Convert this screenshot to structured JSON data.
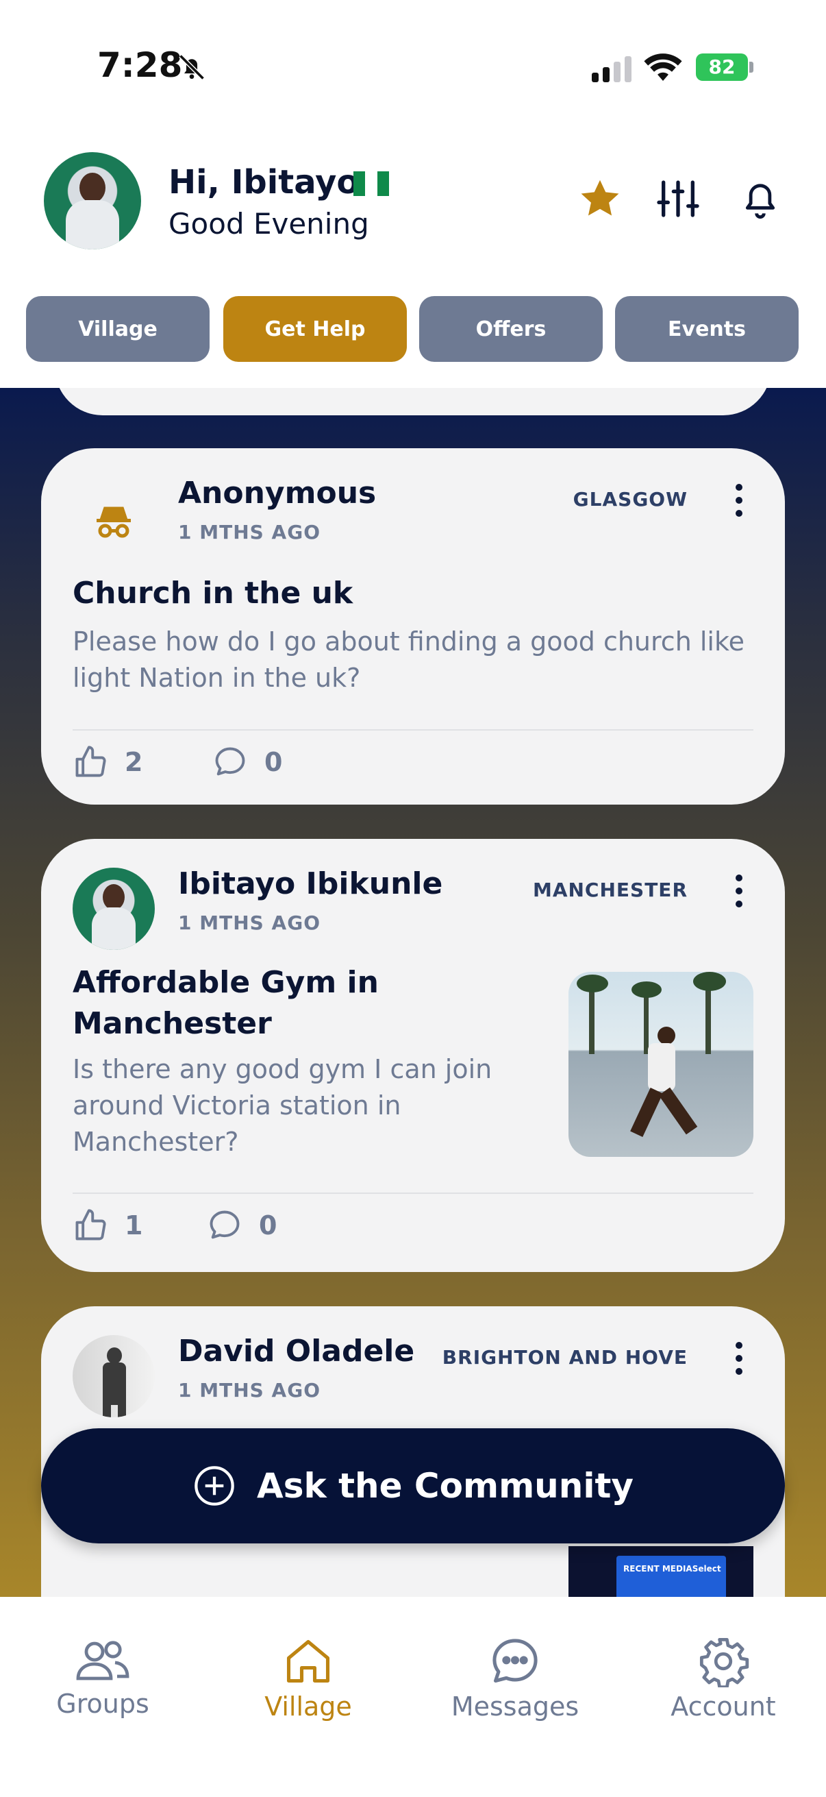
{
  "status_bar": {
    "time": "7:28",
    "battery": "82"
  },
  "header": {
    "greeting": "Hi, Ibitayo",
    "subgreeting": "Good Evening"
  },
  "tabs": [
    {
      "label": "Village"
    },
    {
      "label": "Get Help",
      "active": true
    },
    {
      "label": "Offers"
    },
    {
      "label": "Events"
    }
  ],
  "posts": [
    {
      "author": "Anonymous",
      "time": "1 MTHS AGO",
      "location": "GLASGOW",
      "title": "Church in the uk",
      "body": "Please how do I go about finding a good church like light Nation in the uk?",
      "likes": "2",
      "comments": "0"
    },
    {
      "author": "Ibitayo Ibikunle",
      "time": "1 MTHS AGO",
      "location": "MANCHESTER",
      "title": "Affordable Gym in Manchester",
      "body": "Is there any good gym I can join around Victoria station in Manchester?",
      "likes": "1",
      "comments": "0"
    },
    {
      "author": "David Oladele",
      "time": "1 MTHS AGO",
      "location": "BRIGHTON AND HOVE"
    }
  ],
  "thumbnail_text": "RECENT MEDIASelect",
  "cta_label": "Ask the Community",
  "bottom_nav": [
    {
      "label": "Groups"
    },
    {
      "label": "Village",
      "active": true
    },
    {
      "label": "Messages"
    },
    {
      "label": "Account"
    }
  ],
  "colors": {
    "accent": "#bd8412",
    "navy": "#061237",
    "tab_inactive": "#6e7a93",
    "card": "#f3f3f4"
  }
}
